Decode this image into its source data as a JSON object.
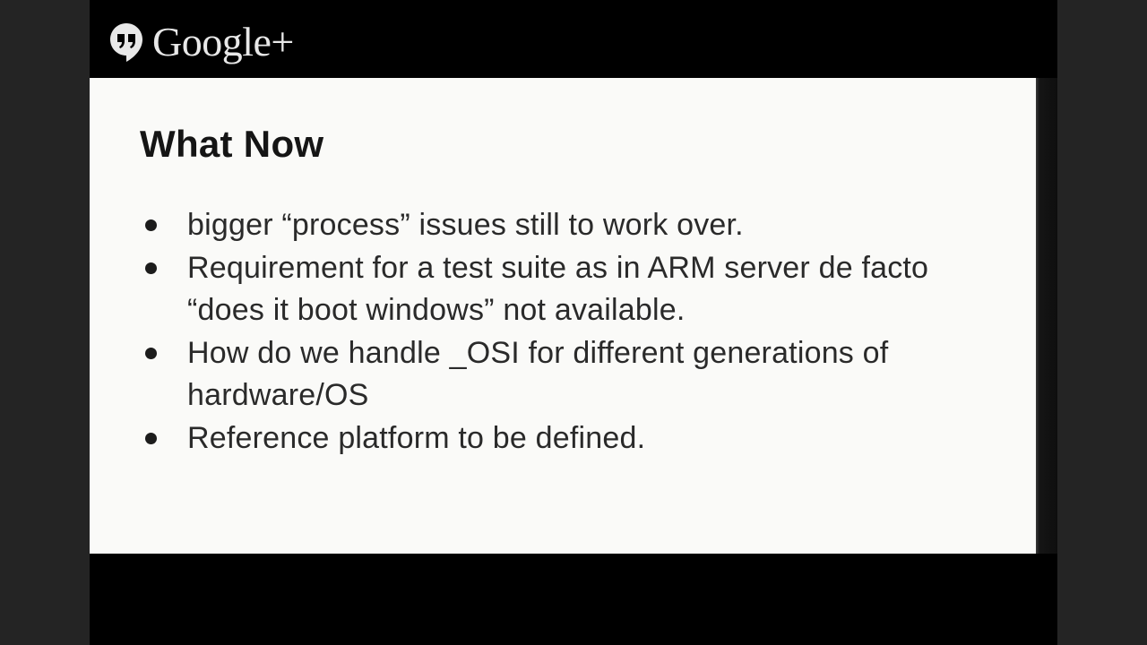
{
  "header": {
    "brand_text": "Google+",
    "brand_icon": "hangouts-quote-icon"
  },
  "slide": {
    "title": "What Now",
    "bullets": [
      "bigger “process” issues still to work over.",
      "Requirement for a test suite as in ARM server de facto “does it boot windows” not available.",
      "How do we handle _OSI for different generations of hardware/OS",
      "Reference platform to be defined."
    ]
  },
  "colors": {
    "background": "#242424",
    "frame": "#000000",
    "slide": "#fafaf8",
    "text": "#2a2a2a"
  }
}
